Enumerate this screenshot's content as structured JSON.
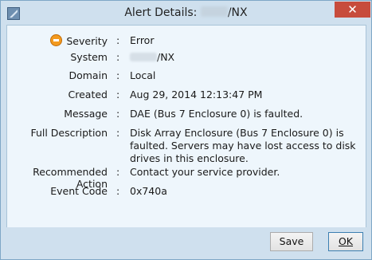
{
  "window": {
    "title_prefix": "Alert Details:",
    "title_suffix": "/NX",
    "close_glyph": "✕"
  },
  "fields": [
    {
      "label": "Severity",
      "value": "Error"
    },
    {
      "label": "System",
      "value": "/NX"
    },
    {
      "label": "Domain",
      "value": "Local"
    },
    {
      "label": "Created",
      "value": "Aug 29, 2014 12:13:47 PM"
    },
    {
      "label": "Message",
      "value": "DAE (Bus 7 Enclosure 0) is faulted."
    },
    {
      "label": "Full Description",
      "value": "Disk Array Enclosure (Bus 7 Enclosure 0) is faulted. Servers may have lost access to disk drives in this enclosure."
    },
    {
      "label": "Recommended Action",
      "value": "Contact your service provider."
    },
    {
      "label": "Event Code",
      "value": "0x740a"
    }
  ],
  "colon": ":",
  "buttons": {
    "save": "Save",
    "ok": "OK"
  },
  "icons": {
    "app": "app-icon",
    "severity": "error-severity-icon",
    "close": "close-icon"
  }
}
